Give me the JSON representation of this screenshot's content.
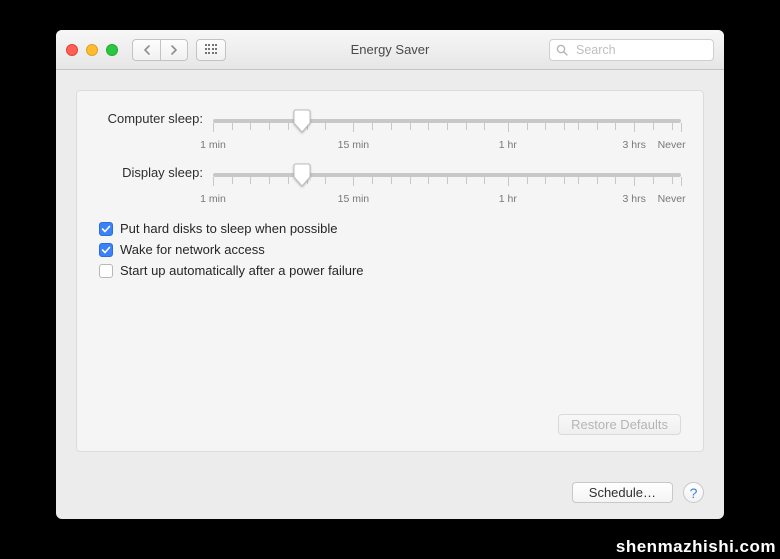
{
  "window": {
    "title": "Energy Saver"
  },
  "search": {
    "placeholder": "Search"
  },
  "sliders": {
    "computer": {
      "label": "Computer sleep:"
    },
    "display": {
      "label": "Display sleep:"
    },
    "tick_labels": {
      "min1": "1 min",
      "min15": "15 min",
      "hr1": "1 hr",
      "hr3": "3 hrs",
      "never": "Never"
    },
    "computer_pos_pct": 19,
    "display_pos_pct": 19,
    "major_tick_pcts": [
      0,
      30,
      63,
      90,
      100
    ]
  },
  "checks": {
    "hard_disks": {
      "label": "Put hard disks to sleep when possible",
      "checked": true
    },
    "wake_net": {
      "label": "Wake for network access",
      "checked": true
    },
    "startup_power": {
      "label": "Start up automatically after a power failure",
      "checked": false
    }
  },
  "buttons": {
    "restore_defaults": "Restore Defaults",
    "schedule": "Schedule…"
  },
  "colors": {
    "accent": "#3b82f6"
  },
  "watermark": "shenmazhishi.com"
}
